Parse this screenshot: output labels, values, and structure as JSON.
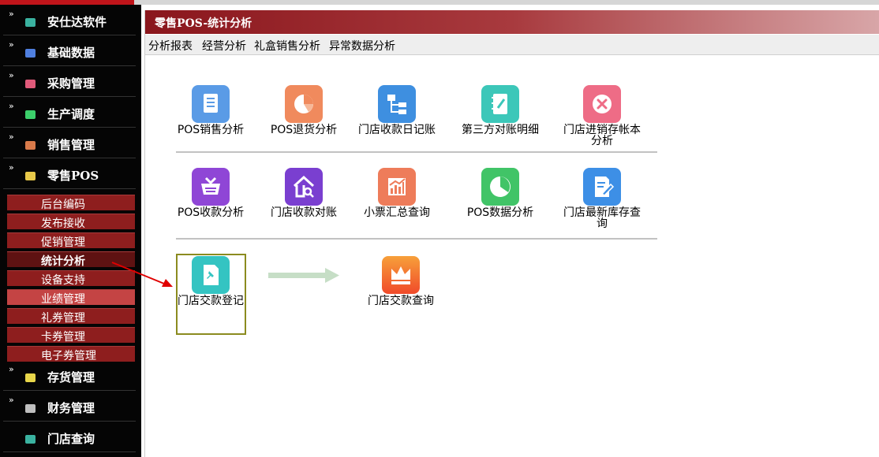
{
  "sidebar": {
    "menus": [
      {
        "label": "安仕达软件",
        "icon": "teal-cube-icon",
        "color": "#3ab2a0"
      },
      {
        "label": "基础数据",
        "icon": "blue-cube-icon",
        "color": "#4f7fe0"
      },
      {
        "label": "采购管理",
        "icon": "pink-cube-icon",
        "color": "#e05a7a"
      },
      {
        "label": "生产调度",
        "icon": "green-cube-icon",
        "color": "#3ccf6b"
      },
      {
        "label": "销售管理",
        "icon": "orange-cube-icon",
        "color": "#d97a4a"
      },
      {
        "label": "零售POS",
        "icon": "yellow-cube-icon",
        "color": "#e8c94a"
      }
    ],
    "submenu": [
      "后台编码",
      "发布接收",
      "促销管理",
      "统计分析",
      "设备支持",
      "业绩管理",
      "礼券管理",
      "卡券管理",
      "电子券管理"
    ],
    "menus_after": [
      {
        "label": "存货管理",
        "icon": "yellow-cube-icon",
        "color": "#e8d64a"
      },
      {
        "label": "财务管理",
        "icon": "gray-cube-icon",
        "color": "#bfbfbf"
      },
      {
        "label": "门店查询",
        "icon": "teal-cube-icon",
        "color": "#3ab2a0"
      }
    ]
  },
  "main": {
    "title": "零售POS-统计分析",
    "tabs": [
      "分析报表",
      "经营分析",
      "礼盒销售分析",
      "异常数据分析"
    ],
    "items": [
      {
        "label": "POS销售分析",
        "color": "#5a9be6",
        "icon": "document-list-icon"
      },
      {
        "label": "POS退货分析",
        "color": "#f08a5d",
        "icon": "pie-chart-icon"
      },
      {
        "label": "门店收款日记账",
        "color": "#3e8fe0",
        "icon": "org-chart-icon"
      },
      {
        "label": "第三方对账明细",
        "color": "#3cc7b9",
        "icon": "notebook-icon"
      },
      {
        "label": "门店进销存帐本分析",
        "color": "#ee6c86",
        "icon": "close-circle-icon"
      },
      {
        "label": "POS收款分析",
        "color": "#8f46d6",
        "icon": "basket-icon"
      },
      {
        "label": "门店收款对账",
        "color": "#7a3fd0",
        "icon": "house-search-icon"
      },
      {
        "label": "小票汇总查询",
        "color": "#ee7c5a",
        "icon": "bar-chart-icon"
      },
      {
        "label": "POS数据分析",
        "color": "#41c467",
        "icon": "pie-chart-icon"
      },
      {
        "label": "门店最新库存查询",
        "color": "#3d8fe6",
        "icon": "edit-document-icon"
      },
      {
        "label": "门店交款登记",
        "color": "#34c4c2",
        "icon": "pin-document-icon"
      },
      {
        "label": "门店交款查询",
        "color": "#f05a30",
        "icon": "crown-icon"
      }
    ]
  }
}
